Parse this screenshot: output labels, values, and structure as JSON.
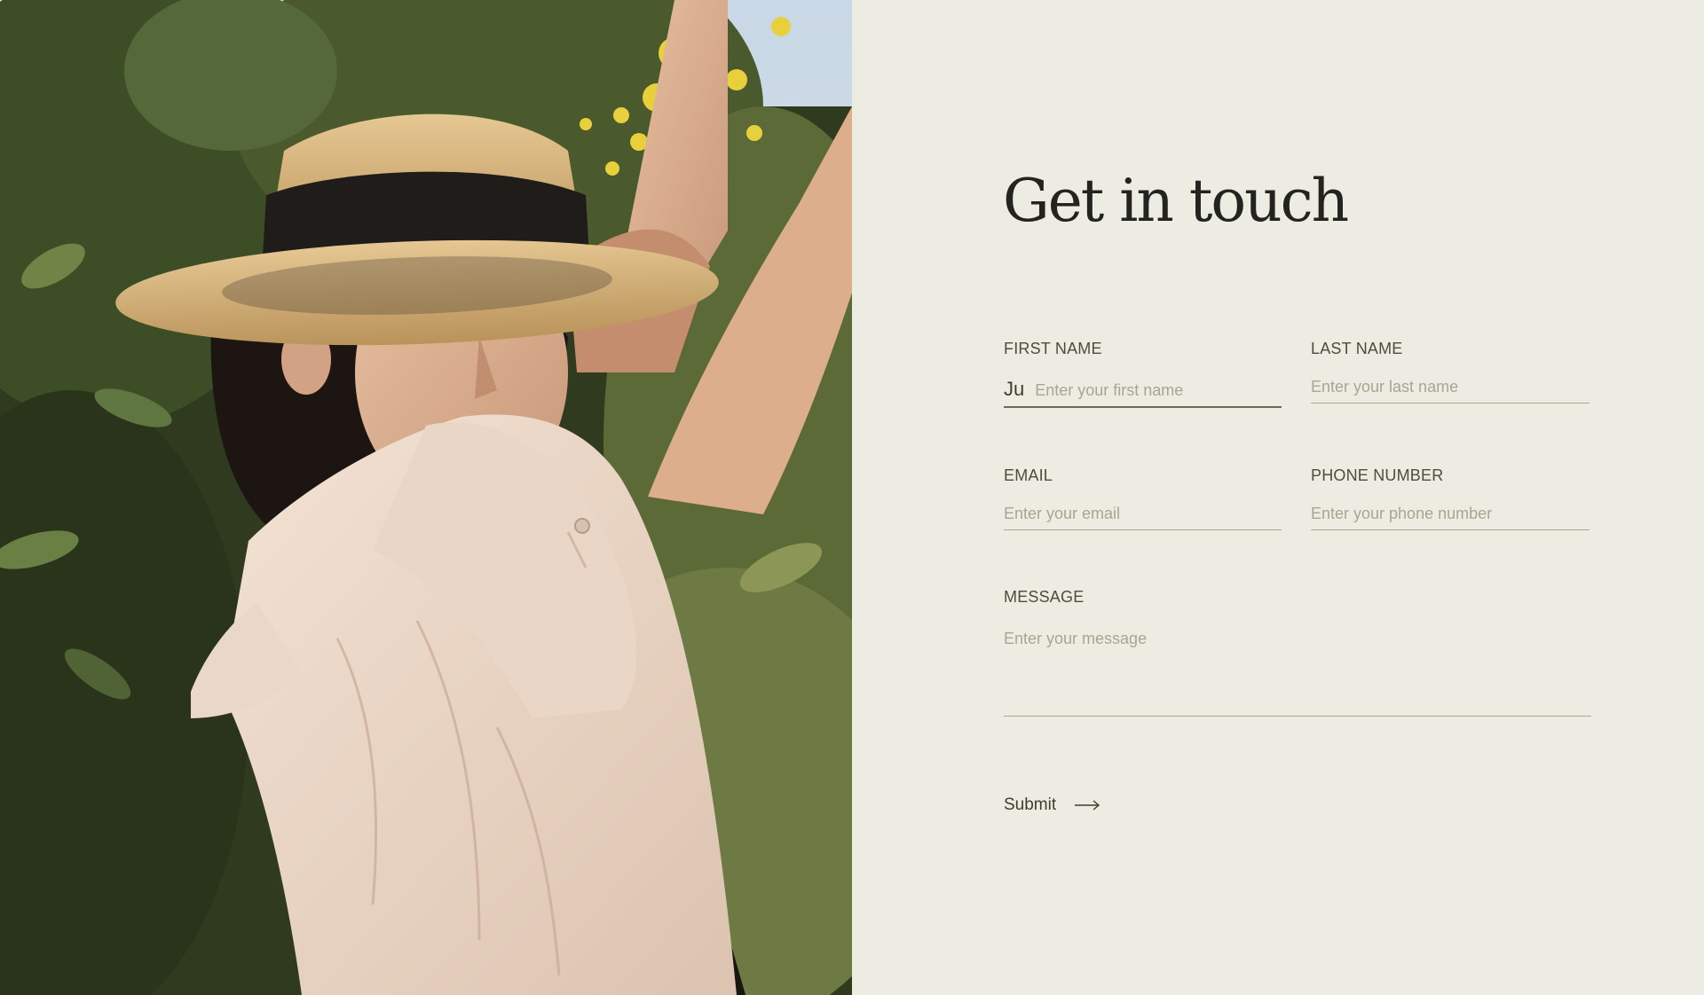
{
  "photo": {
    "description_icon": "woman-in-straw-hat-photo"
  },
  "form": {
    "title": "Get in touch",
    "fields": {
      "first_name": {
        "label": "FIRST NAME",
        "value": "Ju",
        "placeholder": "Enter your first name"
      },
      "last_name": {
        "label": "LAST NAME",
        "value": "",
        "placeholder": "Enter your last name"
      },
      "email": {
        "label": "EMAIL",
        "value": "",
        "placeholder": "Enter your email"
      },
      "phone": {
        "label": "PHONE NUMBER",
        "value": "",
        "placeholder": "Enter your phone number"
      },
      "message": {
        "label": "MESSAGE",
        "value": "",
        "placeholder": "Enter your message"
      }
    },
    "submit": {
      "label": "Submit",
      "icon": "arrow-right-icon"
    }
  },
  "colors": {
    "background": "#edece2",
    "heading": "#23231f",
    "label": "#4e4d3c",
    "placeholder": "#a7a693",
    "underline": "#a9a895"
  }
}
